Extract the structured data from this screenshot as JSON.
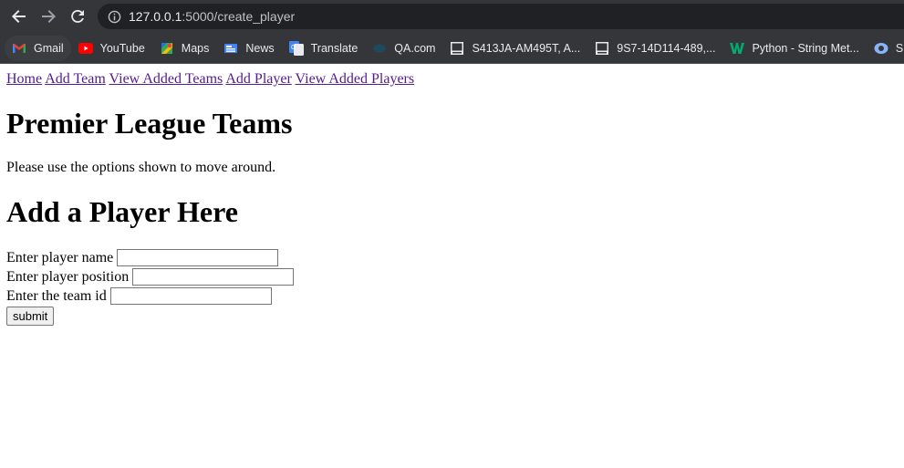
{
  "browser": {
    "url_host": "127.0.0.1",
    "url_path": ":5000/create_player",
    "bookmarks": [
      {
        "label": "Gmail",
        "icon": "gmail-icon"
      },
      {
        "label": "YouTube",
        "icon": "youtube-icon"
      },
      {
        "label": "Maps",
        "icon": "maps-icon"
      },
      {
        "label": "News",
        "icon": "news-icon"
      },
      {
        "label": "Translate",
        "icon": "translate-icon"
      },
      {
        "label": "QA.com",
        "icon": "qa-icon"
      },
      {
        "label": "S413JA-AM495T, A...",
        "icon": "box-icon"
      },
      {
        "label": "9S7-14D114-489,...",
        "icon": "box-icon"
      },
      {
        "label": "Python - String Met...",
        "icon": "w3schools-icon"
      },
      {
        "label": "Sign in t",
        "icon": "signin-icon"
      }
    ]
  },
  "nav": {
    "home": "Home",
    "add_team": "Add Team",
    "view_teams": "View Added Teams",
    "add_player": "Add Player",
    "view_players": "View Added Players"
  },
  "page": {
    "title": "Premier League Teams",
    "intro": "Please use the options shown to move around.",
    "section_title": "Add a Player Here"
  },
  "form": {
    "name_label": "Enter player name",
    "name_value": "",
    "position_label": "Enter player position",
    "position_value": "",
    "team_label": "Enter the team id",
    "team_value": "",
    "submit_label": "submit"
  }
}
